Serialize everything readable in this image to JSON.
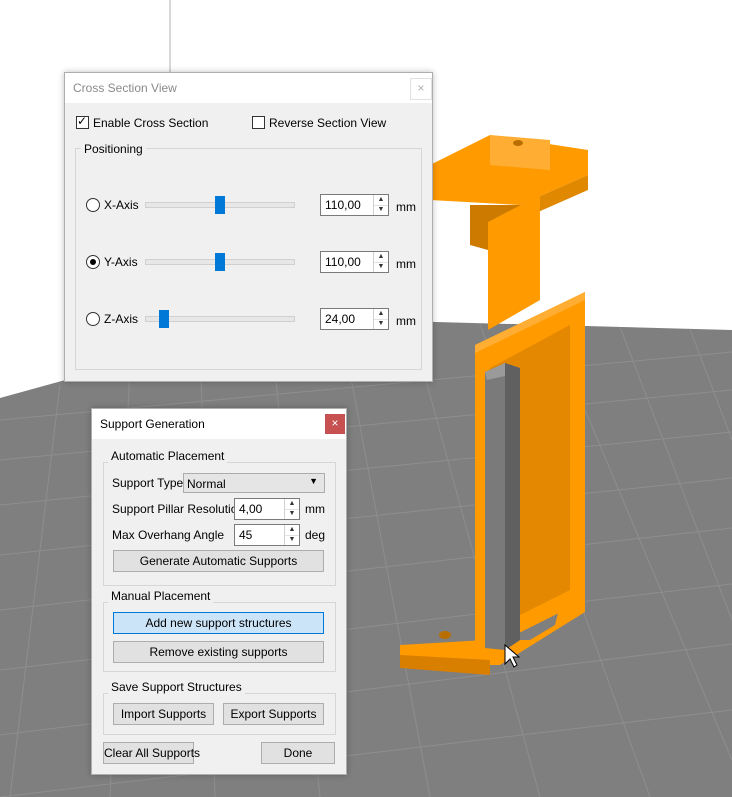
{
  "cross_section": {
    "title": "Cross Section View",
    "close_label": "×",
    "enable_label": "Enable Cross Section",
    "enable_checked": true,
    "reverse_label": "Reverse Section View",
    "reverse_checked": false,
    "positioning_label": "Positioning",
    "unit": "mm",
    "axes": [
      {
        "label": "X-Axis",
        "value": "110,00",
        "selected": false,
        "slider_fraction": 0.5
      },
      {
        "label": "Y-Axis",
        "value": "110,00",
        "selected": true,
        "slider_fraction": 0.5
      },
      {
        "label": "Z-Axis",
        "value": "24,00",
        "selected": false,
        "slider_fraction": 0.11
      }
    ]
  },
  "support": {
    "title": "Support Generation",
    "close_label": "×",
    "automatic": {
      "group_label": "Automatic Placement",
      "type_label": "Support Type",
      "type_value": "Normal",
      "resolution_label": "Support Pillar Resolution",
      "resolution_value": "4,00",
      "resolution_unit": "mm",
      "angle_label": "Max Overhang Angle",
      "angle_value": "45",
      "angle_unit": "deg",
      "generate_label": "Generate Automatic Supports"
    },
    "manual": {
      "group_label": "Manual Placement",
      "add_label": "Add new support structures",
      "remove_label": "Remove existing supports"
    },
    "save": {
      "group_label": "Save Support Structures",
      "import_label": "Import Supports",
      "export_label": "Export Supports"
    },
    "clear_label": "Clear All Supports",
    "done_label": "Done"
  },
  "colors": {
    "floor": "#7f7f7f",
    "grid": "#8f8f8f",
    "model": "#ff9a00",
    "support_pillar": "#7a7a7a",
    "accent": "#0078d7",
    "close_active": "#c75050"
  },
  "icons": {
    "spin_up": "▲",
    "spin_down": "▼",
    "combo_arrow": "▼",
    "check": "✓"
  }
}
